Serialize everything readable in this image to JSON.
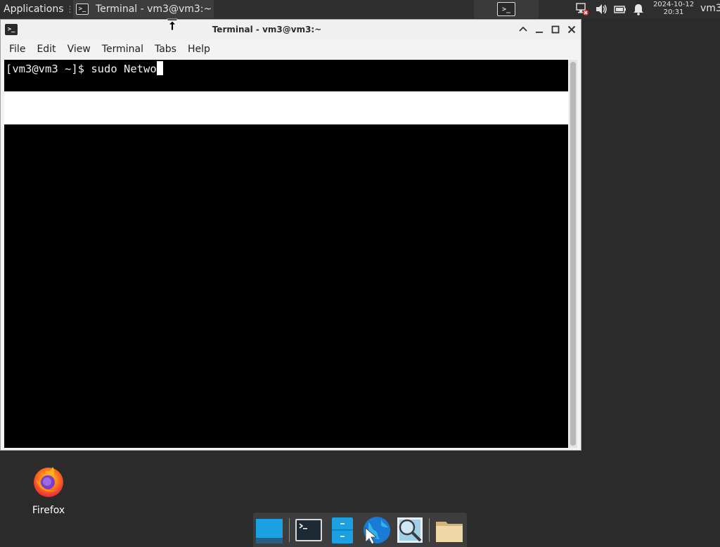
{
  "top_panel": {
    "applications_label": "Applications",
    "applications_separator": "⋮",
    "taskbar_window_label": "Terminal - vm3@vm3:~",
    "terminal_glyph": ">_",
    "clock_date": "2024-10-12",
    "clock_time": "20:31",
    "user": "vm3"
  },
  "window": {
    "title": "Terminal - vm3@vm3:~",
    "menu": [
      "File",
      "Edit",
      "View",
      "Terminal",
      "Tabs",
      "Help"
    ],
    "controls": {
      "shade": "^",
      "minimize": "–",
      "maximize": "□",
      "close": "✕"
    }
  },
  "terminal": {
    "prompt": "[vm3@vm3 ~]$ ",
    "typed_command": "sudo Netwo"
  },
  "desktop": {
    "icons": [
      {
        "label": "Firefox",
        "icon": "firefox-icon"
      }
    ]
  },
  "dock": {
    "items": [
      "show-desktop-icon",
      "terminal-icon",
      "file-manager-icon",
      "web-browser-icon",
      "app-finder-icon",
      "folder-icon"
    ]
  },
  "colors": {
    "panel_bg": "#2e2e2e",
    "desktop_bg": "#2b2b2b",
    "terminal_bg": "#000000",
    "accent_blue": "#1ba1e2"
  }
}
